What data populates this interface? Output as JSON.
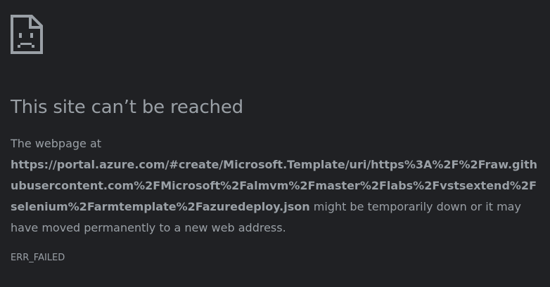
{
  "icon": "sad-page-icon",
  "title": "This site can’t be reached",
  "message": {
    "prefix": "The webpage at",
    "url": "https://portal.azure.com/#create/Microsoft.Template/uri/https%3A%2F%2Fraw.githubusercontent.com%2FMicrosoft%2Falmvm%2Fmaster%2Flabs%2Fvstsextend%2Fselenium%2Farmtemplate%2Fazuredeploy.json",
    "suffix": "might be temporarily down or it may have moved permanently to a new web address."
  },
  "error_code": "ERR_FAILED",
  "colors": {
    "background": "#202124",
    "text": "#9aa0a6"
  }
}
